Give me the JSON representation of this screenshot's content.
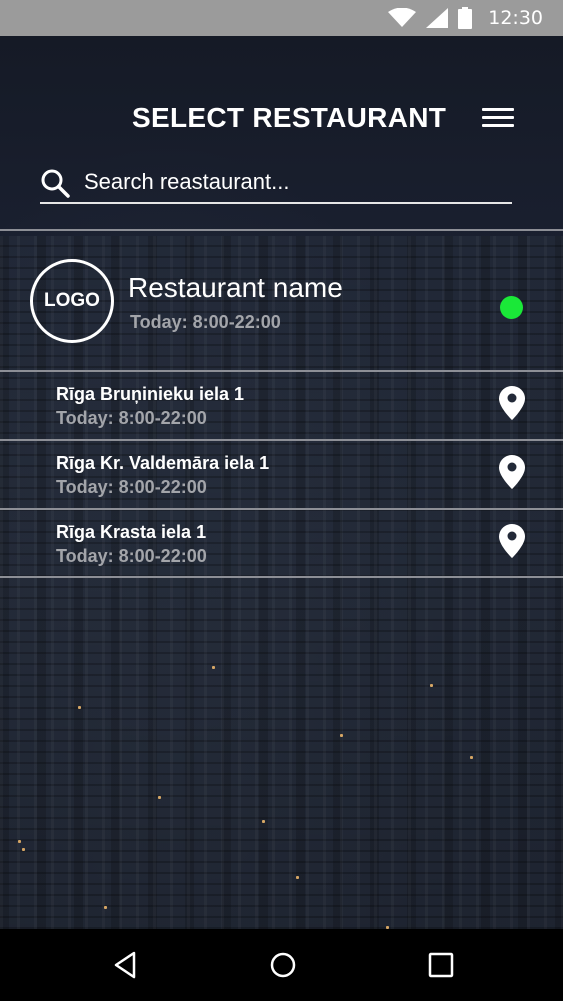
{
  "status_bar": {
    "time": "12:30",
    "icons": [
      "wifi-icon",
      "cell-signal-icon",
      "battery-icon"
    ]
  },
  "header": {
    "title": "SELECT RESTAURANT",
    "menu_icon": "hamburger-menu-icon"
  },
  "search": {
    "placeholder": "Search reastaurant...",
    "value": "",
    "icon": "search-icon"
  },
  "restaurant": {
    "logo_text": "LOGO",
    "name": "Restaurant name",
    "hours": "Today: 8:00-22:00",
    "status_color": "#1ae838"
  },
  "locations": [
    {
      "name": "Rīga Bruņinieku iela 1",
      "hours": "Today: 8:00-22:00",
      "icon": "location-pin-icon"
    },
    {
      "name": "Rīga Kr. Valdemāra iela 1",
      "hours": "Today: 8:00-22:00",
      "icon": "location-pin-icon"
    },
    {
      "name": "Rīga Krasta iela 1",
      "hours": "Today: 8:00-22:00",
      "icon": "location-pin-icon"
    }
  ],
  "nav_bar": {
    "buttons": [
      "back-icon",
      "home-icon",
      "recents-icon"
    ]
  },
  "colors": {
    "status_bar": "#9b9b9b",
    "open_indicator": "#1ae838",
    "nav_bar": "#000000",
    "secondary_text": "#a3a5aa"
  }
}
